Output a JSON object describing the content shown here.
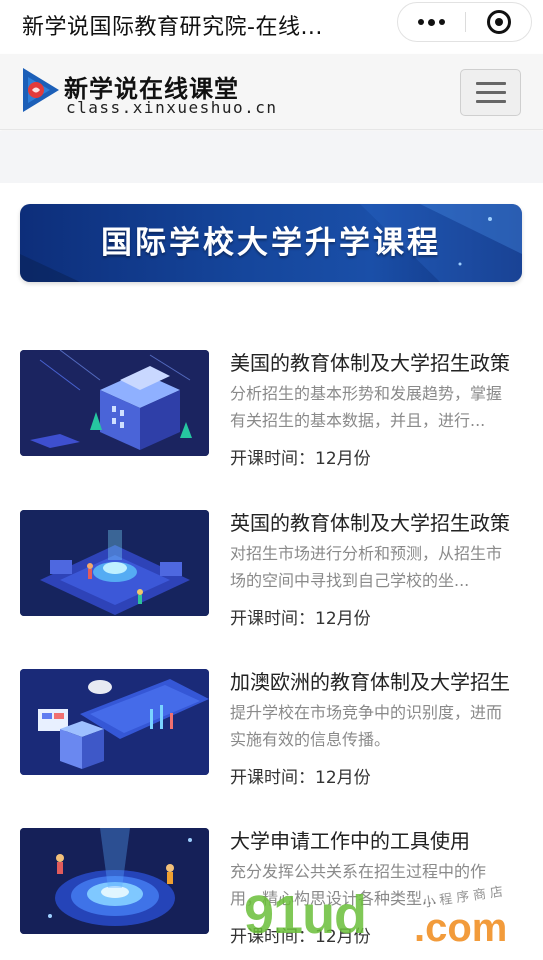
{
  "topbar": {
    "title": "新学说国际教育研究院-在线..."
  },
  "header": {
    "site_name": "新学说在线课堂",
    "domain": "class.xinxueshuo.cn"
  },
  "banner": {
    "title": "国际学校大学升学课程"
  },
  "courses": [
    {
      "title": "美国的教育体制及大学招生政策",
      "description": "分析招生的基本形势和发展趋势，掌握有关招生的基本数据，并且，进行...",
      "time": "开课时间：12月份"
    },
    {
      "title": "英国的教育体制及大学招生政策",
      "description": "对招生市场进行分析和预测，从招生市场的空间中寻找到自己学校的坐...",
      "time": "开课时间：12月份"
    },
    {
      "title": "加澳欧洲的教育体制及大学招生",
      "description": "提升学校在市场竞争中的识别度，进而实施有效的信息传播。",
      "time": "开课时间：12月份"
    },
    {
      "title": "大学申请工作中的工具使用",
      "description": "充分发挥公共关系在招生过程中的作用，精心构思设计各种类型...",
      "time": "开课时间：12月份"
    }
  ],
  "watermark": {
    "brand": "91ud",
    "tld": ".com",
    "tagline": "小程序商店"
  },
  "colors": {
    "banner_blue": "#15469c",
    "thumb_navy": "#16245a",
    "watermark_green": "#6bbf3a",
    "watermark_orange": "#f08a1a"
  },
  "icons": {
    "more": "more-dots-icon",
    "close": "close-target-icon",
    "menu": "hamburger-icon",
    "logo": "play-logo-icon"
  }
}
